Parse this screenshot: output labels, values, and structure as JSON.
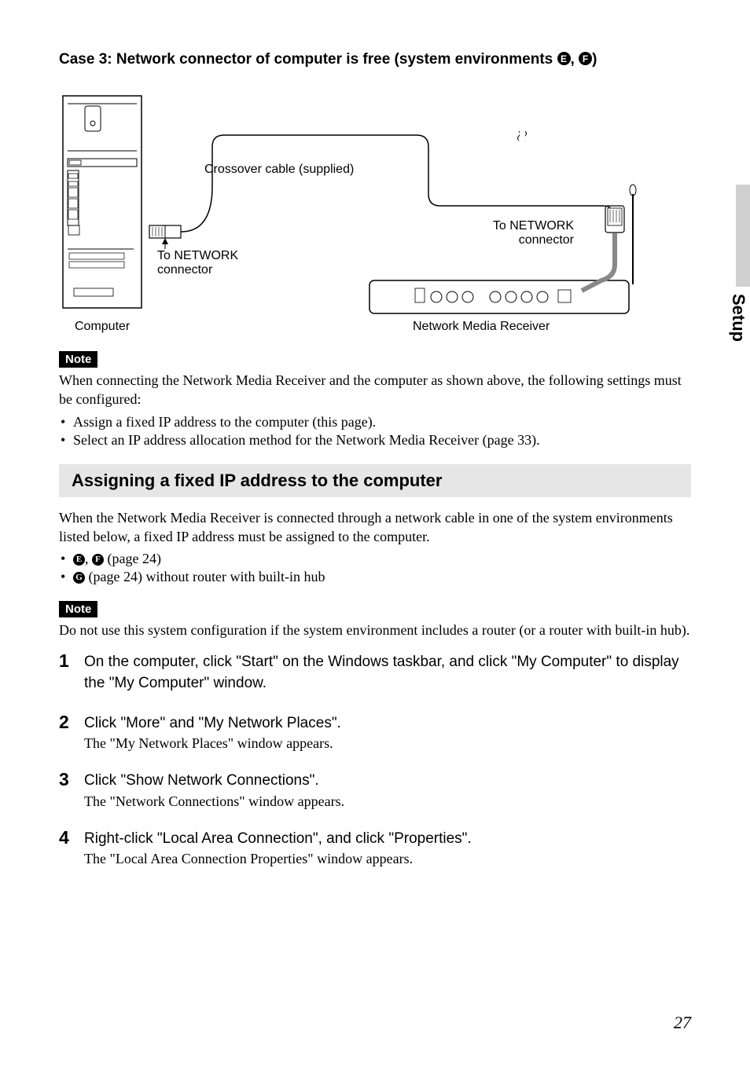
{
  "caseTitle": {
    "prefix": "Case 3: Network connector of computer is free (system environments ",
    "letters": [
      "E",
      "F"
    ],
    "suffix": ")"
  },
  "diagram": {
    "crossover": "Crossover cable (supplied)",
    "toNetworkLeft": "To NETWORK connector",
    "toNetworkRight": "To NETWORK connector",
    "computer": "Computer",
    "receiver": "Network Media Receiver"
  },
  "note1": {
    "badge": "Note",
    "text": "When connecting the Network Media Receiver and the computer as shown above, the following settings must be configured:",
    "items": [
      "Assign a fixed IP address to the computer (this page).",
      "Select an IP address allocation method for the Network Media Receiver (page 33)."
    ]
  },
  "sectionHeader": "Assigning a fixed IP address to the computer",
  "intro": "When the Network Media Receiver is connected through a network cable in one of the system environments listed below, a fixed IP address must be assigned to the computer.",
  "envBulletsSuffix1": " (page 24)",
  "envBulletsSuffix2": " (page 24) without router with built-in hub",
  "envLetters1": [
    "E",
    "F"
  ],
  "envLetters2": [
    "G"
  ],
  "note2": {
    "badge": "Note",
    "text": "Do not use this system configuration if the system environment includes a router (or a router with built-in hub)."
  },
  "steps": [
    {
      "num": "1",
      "action": "On the computer, click \"Start\" on the Windows taskbar, and click \"My Computer\" to display the \"My Computer\" window.",
      "result": ""
    },
    {
      "num": "2",
      "action": "Click \"More\" and \"My Network Places\".",
      "result": "The \"My Network Places\" window appears."
    },
    {
      "num": "3",
      "action": "Click \"Show Network Connections\".",
      "result": "The \"Network Connections\" window appears."
    },
    {
      "num": "4",
      "action": "Right-click \"Local Area Connection\", and click \"Properties\".",
      "result": "The \"Local Area Connection Properties\" window appears."
    }
  ],
  "sideTab": "Setup",
  "pageNum": "27"
}
